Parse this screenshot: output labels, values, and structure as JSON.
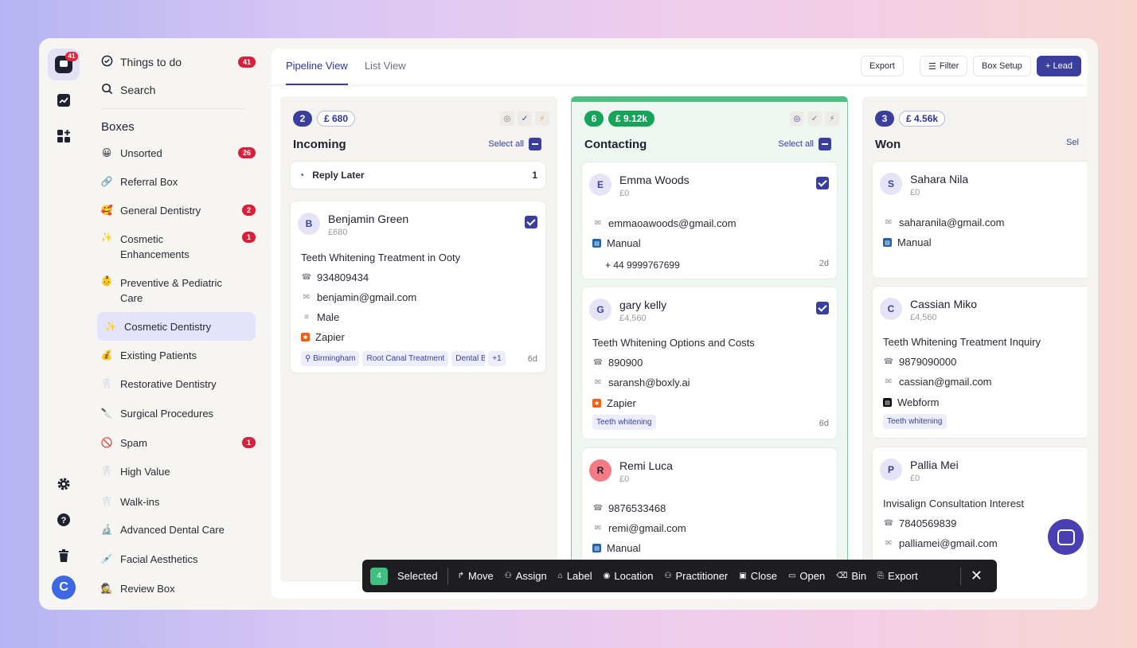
{
  "rail": {
    "logo_badge": "41",
    "avatar_initial": "C"
  },
  "sidebar": {
    "top": [
      {
        "label": "Things to do",
        "badge": "41"
      },
      {
        "label": "Search"
      }
    ],
    "heading": "Boxes",
    "boxes": [
      {
        "icon": "😀",
        "label": "Unsorted",
        "badge": "26"
      },
      {
        "icon": "🔗",
        "label": "Referral Box"
      },
      {
        "icon": "🥰",
        "label": "General Dentistry",
        "badge": "2"
      },
      {
        "icon": "✨",
        "label": "Cosmetic Enhancements",
        "badge": "1"
      },
      {
        "icon": "👶",
        "label": "Preventive & Pediatric Care"
      },
      {
        "icon": "✨",
        "label": "Cosmetic Dentistry",
        "active": true
      },
      {
        "icon": "💰",
        "label": "Existing Patients"
      },
      {
        "icon": "🦷",
        "label": "Restorative Dentistry"
      },
      {
        "icon": "🔪",
        "label": "Surgical Procedures"
      },
      {
        "icon": "🚫",
        "label": "Spam",
        "badge": "1"
      },
      {
        "icon": "🦷",
        "label": "High Value"
      },
      {
        "icon": "🦷",
        "label": "Walk-ins"
      },
      {
        "icon": "🔬",
        "label": "Advanced Dental Care"
      },
      {
        "icon": "💉",
        "label": "Facial Aesthetics"
      },
      {
        "icon": "🕵",
        "label": "Review Box"
      }
    ]
  },
  "header": {
    "tabs": [
      "Pipeline View",
      "List View"
    ],
    "export": "Export",
    "filter": "Filter",
    "box_setup": "Box Setup",
    "add_lead": "+ Lead"
  },
  "columns": [
    {
      "title": "Incoming",
      "count": "2",
      "amount": "£ 680",
      "select_all": "Select all",
      "reply_later": {
        "label": "Reply Later",
        "count": "1"
      },
      "cards": [
        {
          "initial": "B",
          "name": "Benjamin Green",
          "value": "£680",
          "subject": "Teeth Whitening Treatment in Ooty",
          "phone": "934809434",
          "email": "benjamin@gmail.com",
          "gender": "Male",
          "source": "Zapier",
          "tags": [
            "Birmingham",
            "Root Canal Treatment",
            "Dental B",
            "+1"
          ],
          "age": "6d"
        }
      ]
    },
    {
      "title": "Contacting",
      "count": "6",
      "amount": "£ 9.12k",
      "select_all": "Select all",
      "cards": [
        {
          "initial": "E",
          "name": "Emma Woods",
          "value": "£0",
          "email": "emmaoawoods@gmail.com",
          "source": "Manual",
          "phone": "+ 44 9999767699",
          "age": "2d"
        },
        {
          "initial": "G",
          "name": "gary kelly",
          "value": "£4,560",
          "subject": "Teeth Whitening Options and Costs",
          "phone": "890900",
          "email": "saransh@boxly.ai",
          "source": "Zapier",
          "tags": [
            "Teeth whitening"
          ],
          "age": "6d"
        },
        {
          "initial": "R",
          "name": "Remi Luca",
          "value": "£0",
          "phone": "9876533468",
          "email": "remi@gmail.com",
          "source": "Manual"
        }
      ]
    },
    {
      "title": "Won",
      "count": "3",
      "amount": "£ 4.56k",
      "select_all": "Sel",
      "cards": [
        {
          "initial": "S",
          "name": "Sahara Nila",
          "value": "£0",
          "email": "saharanila@gmail.com",
          "source": "Manual"
        },
        {
          "initial": "C",
          "name": "Cassian Miko",
          "value": "£4,560",
          "subject": "Teeth Whitening Treatment Inquiry",
          "phone": "9879090000",
          "email": "cassian@gmail.com",
          "source": "Webform",
          "tags": [
            "Teeth whitening"
          ]
        },
        {
          "initial": "P",
          "name": "Pallia Mei",
          "value": "£0",
          "subject": "Invisalign Consultation Interest",
          "phone": "7840569839",
          "email": "palliamei@gmail.com"
        }
      ]
    }
  ],
  "bulkbar": {
    "count": "4",
    "selected": "Selected",
    "actions": [
      "Move",
      "Assign",
      "Label",
      "Location",
      "Practitioner",
      "Close",
      "Open",
      "Bin",
      "Export"
    ]
  },
  "colors": {
    "accent": "#3a3f9d",
    "green": "#16a35a",
    "badge_red": "#d91f3a",
    "toolbar": "#1d1d22"
  }
}
